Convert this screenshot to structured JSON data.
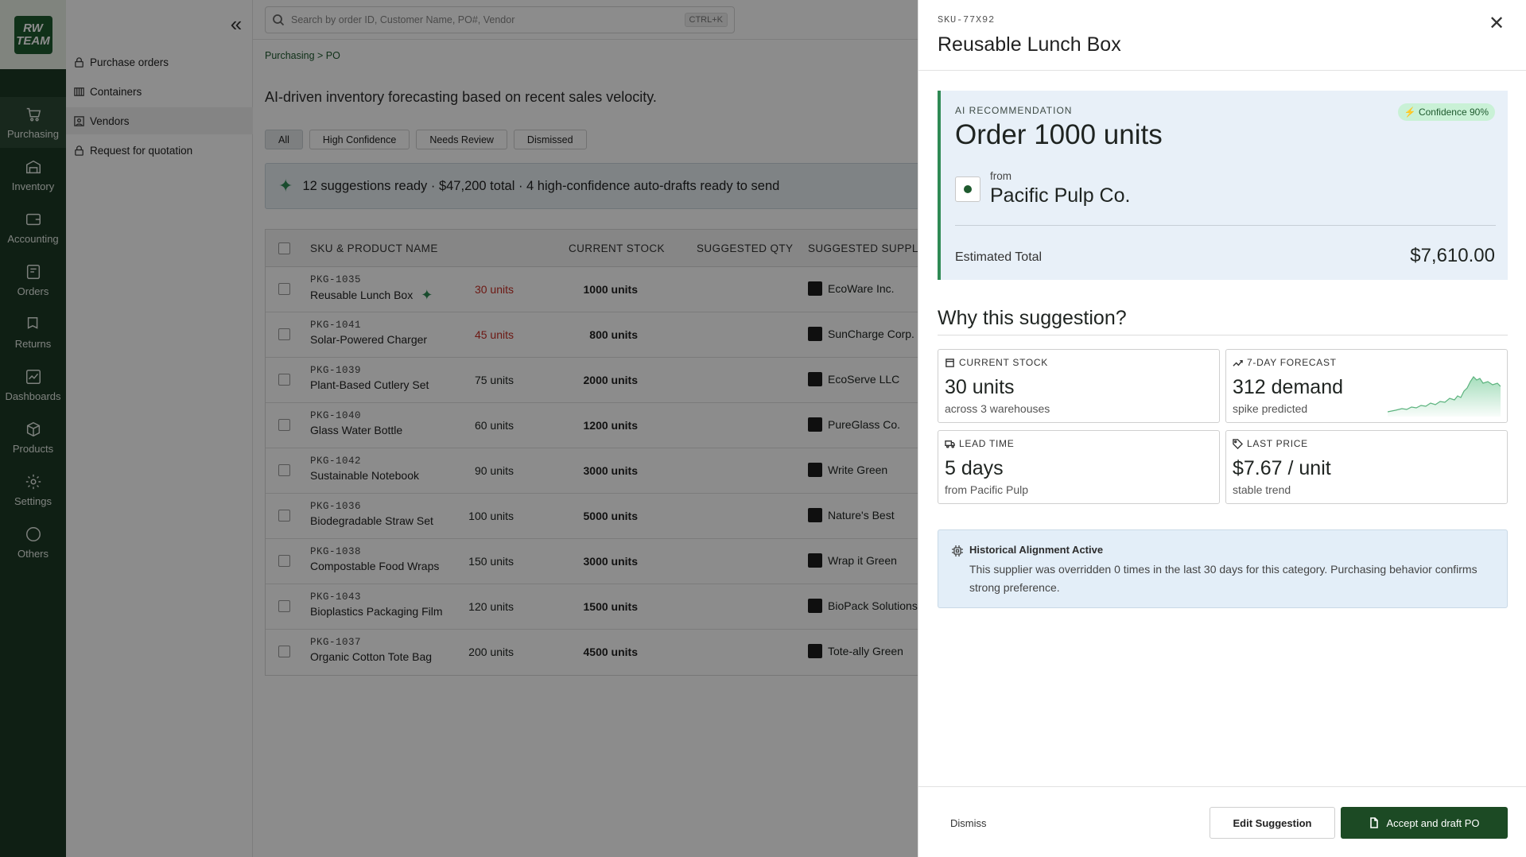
{
  "brand": {
    "logo_text_1": "RW",
    "logo_text_2": "TEAM"
  },
  "rail": [
    {
      "label": "Purchasing",
      "icon": "cart-icon",
      "active": true
    },
    {
      "label": "Inventory",
      "icon": "warehouse-icon"
    },
    {
      "label": "Accounting",
      "icon": "wallet-icon"
    },
    {
      "label": "Orders",
      "icon": "orders-icon"
    },
    {
      "label": "Returns",
      "icon": "returns-icon"
    },
    {
      "label": "Dashboards",
      "icon": "chart-icon"
    },
    {
      "label": "Products",
      "icon": "box-icon"
    },
    {
      "label": "Settings",
      "icon": "gear-icon"
    },
    {
      "label": "Others",
      "icon": "more-icon"
    }
  ],
  "subnav": [
    {
      "label": "Purchase orders",
      "icon": "lock-icon"
    },
    {
      "label": "Containers",
      "icon": "container-icon"
    },
    {
      "label": "Vendors",
      "icon": "vendor-icon",
      "active": true
    },
    {
      "label": "Request for quotation",
      "icon": "lock-icon"
    }
  ],
  "search": {
    "placeholder": "Search by order ID, Customer Name, PO#, Vendor",
    "shortcut": "CTRL+K"
  },
  "breadcrumb": "Purchasing >  PO",
  "lead": "AI-driven inventory forecasting based on recent sales velocity.",
  "filters": [
    "All",
    "High Confidence",
    "Needs Review",
    "Dismissed"
  ],
  "banner": "12 suggestions ready · $47,200 total · 4 high-confidence auto-drafts ready to send",
  "table": {
    "headers": [
      "SKU & PRODUCT NAME",
      "CURRENT STOCK",
      "SUGGESTED QTY",
      "SUGGESTED SUPPLIER"
    ],
    "rows": [
      {
        "sku": "PKG-1035",
        "name": "Reusable Lunch Box",
        "stock": "30 units",
        "low": true,
        "qty": "1000 units",
        "vendor": "EcoWare Inc.",
        "ai": true
      },
      {
        "sku": "PKG-1041",
        "name": "Solar-Powered Charger",
        "stock": "45 units",
        "low": true,
        "qty": "800 units",
        "vendor": "SunCharge Corp."
      },
      {
        "sku": "PKG-1039",
        "name": "Plant-Based Cutlery Set",
        "stock": "75 units",
        "qty": "2000 units",
        "vendor": "EcoServe LLC"
      },
      {
        "sku": "PKG-1040",
        "name": "Glass Water Bottle",
        "stock": "60 units",
        "qty": "1200 units",
        "vendor": "PureGlass Co."
      },
      {
        "sku": "PKG-1042",
        "name": "Sustainable Notebook",
        "stock": "90 units",
        "qty": "3000 units",
        "vendor": "Write Green"
      },
      {
        "sku": "PKG-1036",
        "name": "Biodegradable Straw Set",
        "stock": "100 units",
        "qty": "5000 units",
        "vendor": "Nature's Best"
      },
      {
        "sku": "PKG-1038",
        "name": "Compostable Food Wraps",
        "stock": "150 units",
        "qty": "3000 units",
        "vendor": "Wrap it Green"
      },
      {
        "sku": "PKG-1043",
        "name": "Bioplastics Packaging Film",
        "stock": "120 units",
        "qty": "1500 units",
        "vendor": "BioPack Solutions"
      },
      {
        "sku": "PKG-1037",
        "name": "Organic Cotton Tote Bag",
        "stock": "200 units",
        "qty": "4500 units",
        "vendor": "Tote-ally Green"
      }
    ]
  },
  "drawer": {
    "sku": "SKU-77X92",
    "title": "Reusable Lunch Box",
    "reco_label": "AI RECOMMENDATION",
    "confidence": "Confidence 90%",
    "reco_main": "Order 1000 units",
    "from_label": "from",
    "supplier": "Pacific Pulp Co.",
    "est_label": "Estimated Total",
    "est_value": "$7,610.00",
    "why_title": "Why this suggestion?",
    "cards": [
      {
        "label": "CURRENT STOCK",
        "icon": "stock-icon",
        "value": "30 units",
        "sub": "across 3 warehouses",
        "alert": true
      },
      {
        "label": "7-DAY FORECAST",
        "icon": "trend-icon",
        "value": "312 demand",
        "sub": "spike predicted"
      },
      {
        "label": "LEAD TIME",
        "icon": "truck-icon",
        "value": "5 days",
        "sub": "from Pacific Pulp"
      },
      {
        "label": "LAST PRICE",
        "icon": "tag-icon",
        "value": "$7.67 / unit",
        "sub": "stable trend"
      }
    ],
    "history_title": "Historical Alignment Active",
    "history_body": "This supplier was overridden 0 times in the last 30 days for this category. Purchasing behavior confirms strong preference.",
    "dismiss": "Dismiss",
    "edit": "Edit Suggestion",
    "accept": "Accept and draft PO"
  },
  "colors": {
    "brand_dark": "#1c3a25",
    "accent_green": "#2f8a55",
    "alert_red": "#c62f25"
  }
}
